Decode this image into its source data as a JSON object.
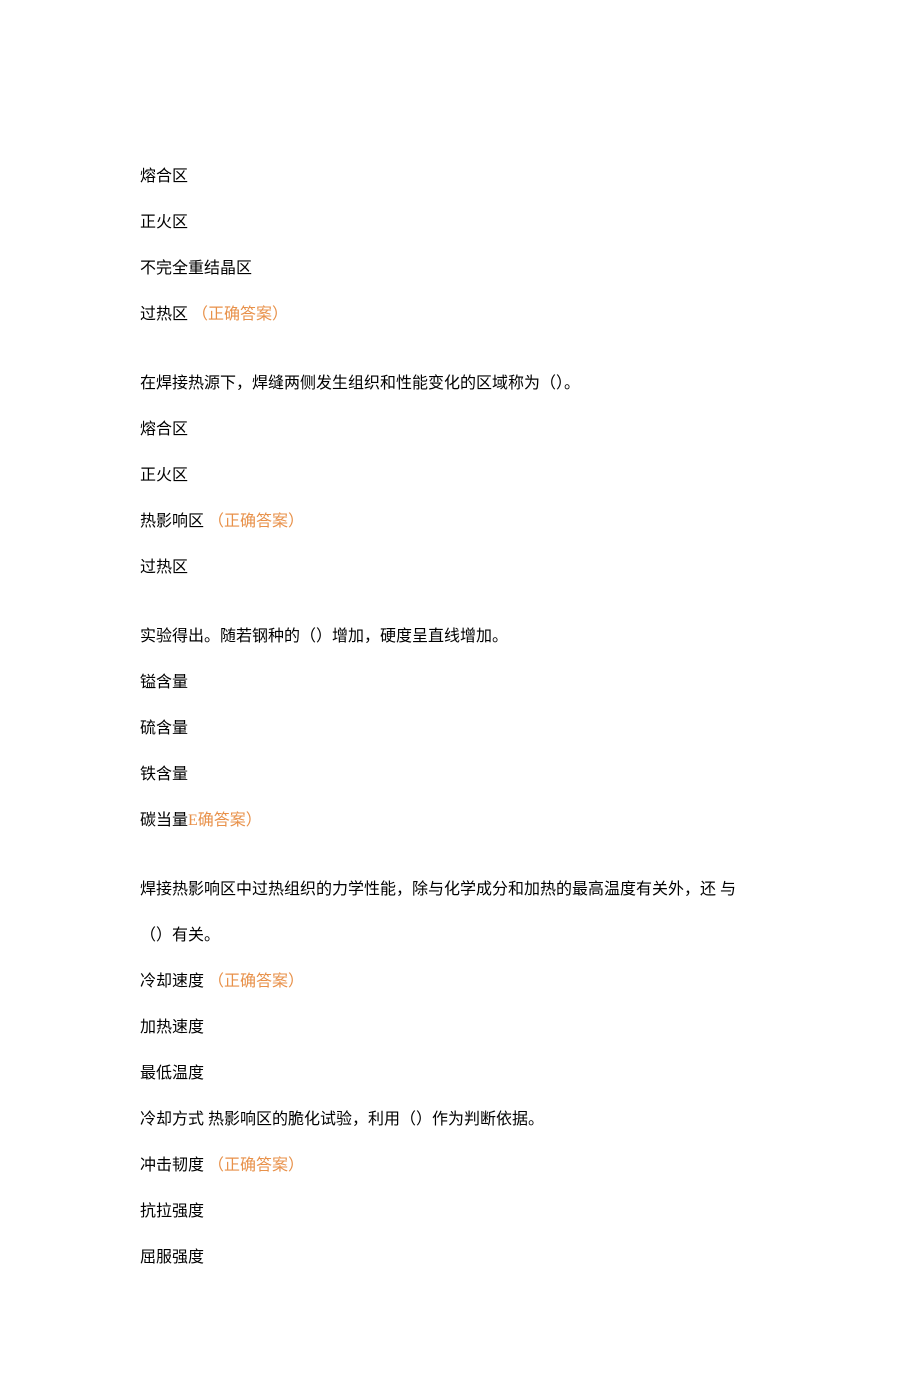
{
  "q1": {
    "opt1": "熔合区",
    "opt2": "正火区",
    "opt3": "不完全重结晶区",
    "opt4_prefix": "过热区",
    "opt4_mark": "（正确答案）"
  },
  "q2": {
    "question": "在焊接热源下，焊缝两侧发生组织和性能变化的区域称为（）。",
    "opt1": "熔合区",
    "opt2": "正火区",
    "opt3_prefix": "热影响区",
    "opt3_mark": "（正确答案）",
    "opt4": "过热区"
  },
  "q3": {
    "question": "实验得出。随若钢种的（）增加，硬度呈直线增加。",
    "opt1": "镒含量",
    "opt2": "硫含量",
    "opt3": "铁含量",
    "opt4_prefix": "碳当量",
    "opt4_mark": "E确答案）"
  },
  "q4": {
    "question_line1": "焊接热影响区中过热组织的力学性能，除与化学成分和加热的最高温度有关外，还 与",
    "question_line2": "（）有关。",
    "opt1_prefix": "冷却速度",
    "opt1_mark": "（正确答案）",
    "opt2": "加热速度",
    "opt3": "最低温度",
    "opt4": "冷却方式 热影响区的脆化试验，利用（）作为判断依据。",
    "opt5_prefix": "冲击韧度",
    "opt5_mark": "（正确答案）",
    "opt6": "抗拉强度",
    "opt7": "屈服强度"
  }
}
